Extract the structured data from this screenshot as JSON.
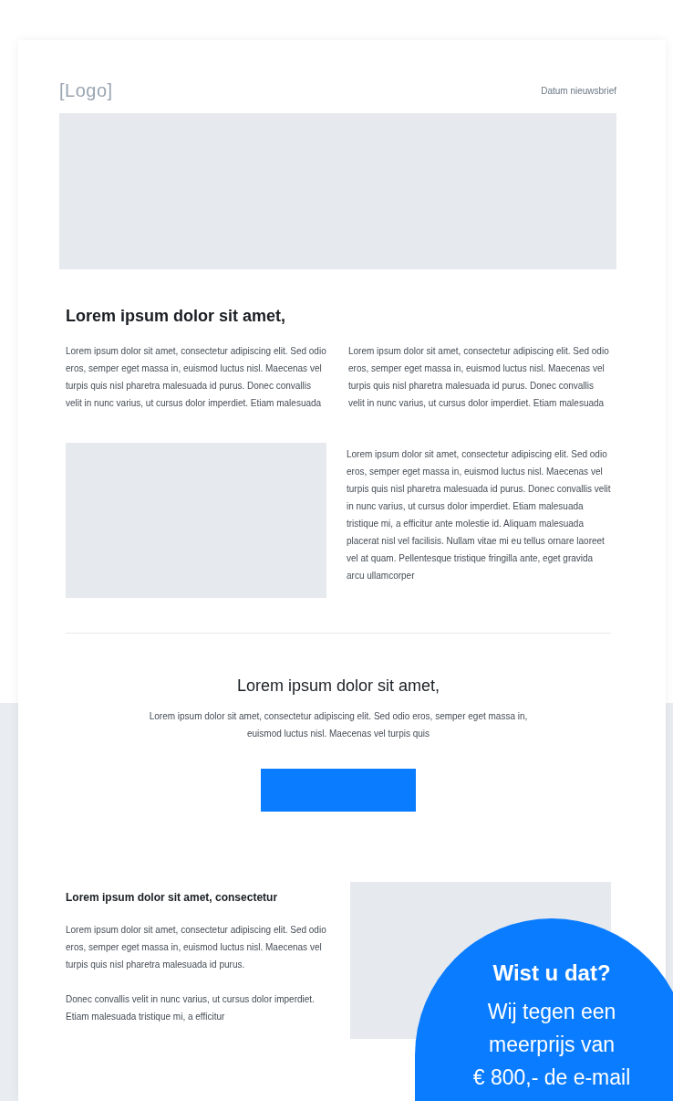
{
  "header": {
    "logo": "[Logo]",
    "date_label": "Datum nieuwsbrief"
  },
  "intro": {
    "title": "Lorem ipsum dolor sit amet,",
    "columns": [
      "Lorem ipsum dolor sit amet, consectetur adipiscing elit. Sed odio eros, semper eget massa in, euismod luctus nisl. Maecenas vel turpis quis nisl pharetra malesuada id purus. Donec convallis velit in nunc varius, ut cursus dolor imperdiet. Etiam malesuada",
      "Lorem ipsum dolor sit amet, consectetur adipiscing elit. Sed odio eros, semper eget massa in, euismod luctus nisl. Maecenas vel turpis quis nisl pharetra malesuada id purus. Donec convallis velit in nunc varius, ut cursus dolor imperdiet. Etiam malesuada"
    ]
  },
  "feature": {
    "text": "Lorem ipsum dolor sit amet, consectetur adipiscing elit. Sed odio eros, semper eget massa in, euismod luctus nisl. Maecenas vel turpis quis nisl pharetra malesuada id purus. Donec convallis velit in nunc varius, ut cursus dolor imperdiet. Etiam malesuada tristique mi, a efficitur ante molestie id. Aliquam malesuada placerat nisl vel facilisis. Nullam vitae mi eu tellus ornare laoreet vel at quam. Pellentesque tristique fringilla ante, eget gravida arcu ullamcorper"
  },
  "cta": {
    "title": "Lorem ipsum dolor sit amet,",
    "text": "Lorem ipsum dolor sit amet, consectetur adipiscing elit. Sed odio eros, semper eget massa in, euismod luctus nisl. Maecenas vel turpis quis"
  },
  "article": {
    "title": "Lorem ipsum dolor sit amet, consectetur",
    "paragraphs": [
      "Lorem ipsum dolor sit amet, consectetur adipiscing elit. Sed odio eros, semper eget massa in, euismod luctus nisl. Maecenas vel turpis quis nisl pharetra malesuada id purus.",
      "Donec convallis velit in nunc varius, ut cursus dolor imperdiet. Etiam malesuada tristique mi, a efficitur"
    ]
  },
  "bubble": {
    "title": "Wist u dat?",
    "lines": [
      "Wij tegen een",
      "meerprijs van",
      "€ 800,- de e-mail"
    ]
  }
}
